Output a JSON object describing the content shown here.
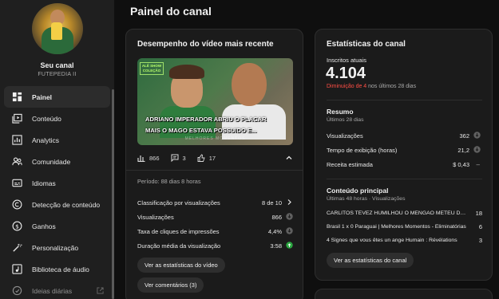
{
  "sidebar": {
    "channel_name": "Seu canal",
    "channel_handle": "FUTEPEDIA II",
    "items": [
      {
        "label": "Painel",
        "icon": "dashboard-icon"
      },
      {
        "label": "Conteúdo",
        "icon": "content-icon"
      },
      {
        "label": "Analytics",
        "icon": "analytics-icon"
      },
      {
        "label": "Comunidade",
        "icon": "community-icon"
      },
      {
        "label": "Idiomas",
        "icon": "subtitles-icon"
      },
      {
        "label": "Detecção de conteúdo",
        "icon": "copyright-icon"
      },
      {
        "label": "Ganhos",
        "icon": "earn-icon"
      },
      {
        "label": "Personalização",
        "icon": "customize-icon"
      },
      {
        "label": "Biblioteca de áudio",
        "icon": "audio-library-icon"
      },
      {
        "label": "Ideias diárias",
        "icon": "ideas-icon"
      }
    ]
  },
  "main": {
    "page_title": "Painel do canal"
  },
  "latest_video": {
    "title": "Desempenho do vídeo mais recente",
    "thumbnail": {
      "caption_line1": "ADRIANO IMPERADOR ABRIU O PLACAR",
      "caption_line2": "MAIS O MAGO ESTAVA POSSUIDO E...",
      "badge": "ALÊ SHOW COLEÇÃO",
      "footer": "MELHORES MOMENTOS"
    },
    "views": "866",
    "comments": "3",
    "likes": "17",
    "period": "Período: 88 dias 8 horas",
    "metrics": [
      {
        "label": "Classificação por visualizações",
        "value": "8 de 10"
      },
      {
        "label": "Visualizações",
        "value": "866"
      },
      {
        "label": "Taxa de cliques de impressões",
        "value": "4,4%"
      },
      {
        "label": "Duração média da visualização",
        "value": "3:58"
      }
    ],
    "btn_stats": "Ver as estatísticas do vídeo",
    "btn_comments": "Ver comentários (3)"
  },
  "channel_stats": {
    "title": "Estatísticas do canal",
    "subs_label": "Inscritos atuais",
    "subs_value": "4.104",
    "subs_change": "Diminuição de 4",
    "subs_change_suffix": " nos últimos 28 dias",
    "summary_title": "Resumo",
    "summary_sub": "Últimos 28 dias",
    "summary": [
      {
        "label": "Visualizações",
        "value": "362"
      },
      {
        "label": "Tempo de exibição (horas)",
        "value": "21,2"
      },
      {
        "label": "Receita estimada",
        "value": "$ 0,43"
      }
    ],
    "top_title": "Conteúdo principal",
    "top_sub": "Últimas 48 horas · Visualizações",
    "top": [
      {
        "title": "CARLITOS TÉVEZ HUMILHOU O MENGÃO METEU DOIS GOLS",
        "value": "18"
      },
      {
        "title": "Brasil 1 x 0 Paraguai | Melhores Momentos - Eliminatórias",
        "value": "6"
      },
      {
        "title": "4 Signes que vous êtes un ange Humain : Révélations",
        "value": "3"
      }
    ],
    "btn": "Ver as estatísticas do canal"
  },
  "colors": {
    "background": "#0f0f0f",
    "sidebar": "#1f1f1f",
    "card": "#1b1b1b",
    "negative": "#ff4e45",
    "positive": "#2ba640"
  }
}
